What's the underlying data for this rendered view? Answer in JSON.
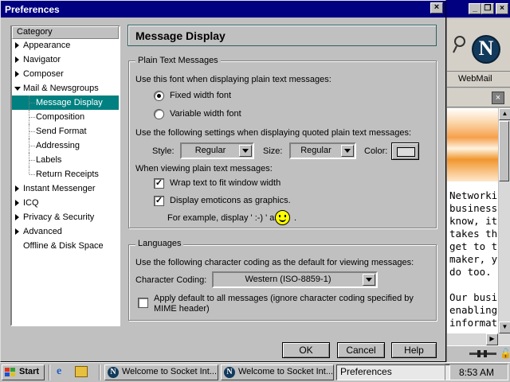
{
  "dialog": {
    "title": "Preferences",
    "close_glyph": "×"
  },
  "category": {
    "header": "Category",
    "items": [
      {
        "label": "Appearance",
        "expandable": true
      },
      {
        "label": "Navigator",
        "expandable": true
      },
      {
        "label": "Composer",
        "expandable": true
      },
      {
        "label": "Mail & Newsgroups",
        "expanded": true
      },
      {
        "label": "Message Display",
        "selected": true,
        "child": true
      },
      {
        "label": "Composition",
        "child": true
      },
      {
        "label": "Send Format",
        "child": true
      },
      {
        "label": "Addressing",
        "child": true
      },
      {
        "label": "Labels",
        "child": true
      },
      {
        "label": "Return Receipts",
        "child": true
      },
      {
        "label": "Instant Messenger",
        "expandable": true
      },
      {
        "label": "ICQ",
        "expandable": true
      },
      {
        "label": "Privacy & Security",
        "expandable": true
      },
      {
        "label": "Advanced",
        "expandable": true
      },
      {
        "label": "Offline & Disk Space"
      }
    ]
  },
  "panel": {
    "title": "Message Display",
    "plain_text": {
      "legend": "Plain Text Messages",
      "font_prompt": "Use this font when displaying plain text messages:",
      "fixed_width": "Fixed width font",
      "fixed_width_selected": true,
      "variable_width": "Variable width font",
      "quoted_prompt": "Use the following settings when displaying quoted plain text messages:",
      "style_label": "Style:",
      "style_value": "Regular",
      "size_label": "Size:",
      "size_value": "Regular",
      "color_label": "Color:",
      "viewing_prompt": "When viewing plain text messages:",
      "wrap_text": "Wrap text to fit window width",
      "wrap_checked": true,
      "emoticons": "Display emoticons as graphics.",
      "emoticons_checked": true,
      "example_prefix": "For example, display ' :-) ' as",
      "example_suffix": "."
    },
    "languages": {
      "legend": "Languages",
      "coding_prompt": "Use the following character coding as the default for viewing messages:",
      "coding_label": "Character Coding:",
      "coding_value": "Western (ISO-8859-1)",
      "apply_default_line1": "Apply default to all messages (ignore character coding specified by",
      "apply_default_line2": "MIME header)",
      "apply_checked": false
    },
    "buttons": {
      "ok": "OK",
      "cancel": "Cancel",
      "help": "Help"
    }
  },
  "background_browser": {
    "toolbar_link": "WebMail",
    "logo_letter": "N",
    "text_lines": [
      "Networkin",
      "business.",
      "know, it's",
      "takes the",
      "get to th",
      "maker, yo",
      "do too.",
      "",
      "Our busin",
      "enabling ",
      "informatio"
    ]
  },
  "taskbar": {
    "start": "Start",
    "tasks": [
      {
        "label": "Welcome to Socket Int...",
        "active": false
      },
      {
        "label": "Welcome to Socket Int...",
        "active": false
      },
      {
        "label": "Preferences",
        "active": true
      }
    ],
    "clock": "8:53 AM"
  },
  "colors": {
    "titlebar": "#000080",
    "selection": "#008080",
    "face": "#c0c0c0"
  }
}
